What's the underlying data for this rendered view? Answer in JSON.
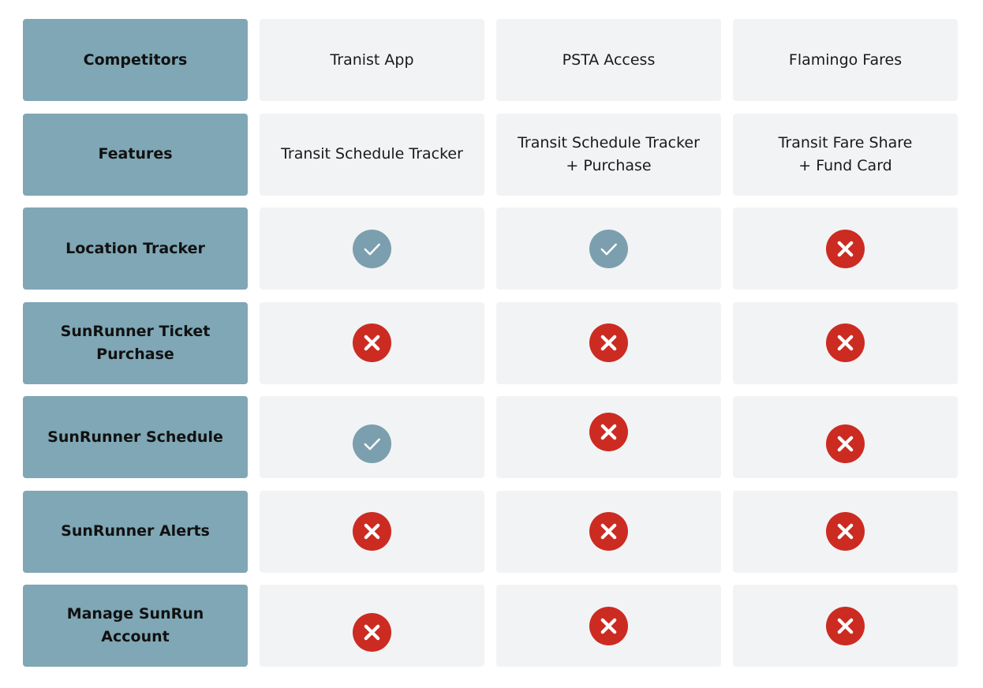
{
  "columns": [
    "Competitors",
    "Tranist App",
    "PSTA Access",
    "Flamingo Fares"
  ],
  "features_row": {
    "label": "Features",
    "values": [
      "Transit Schedule Tracker",
      "Transit Schedule Tracker\n+ Purchase",
      "Transit Fare Share\n+ Fund Card"
    ]
  },
  "rows": [
    {
      "label": "Location Tracker",
      "marks": [
        "check",
        "check",
        "cross"
      ]
    },
    {
      "label": "SunRunner Ticket Purchase",
      "marks": [
        "cross",
        "cross",
        "cross"
      ]
    },
    {
      "label": "SunRunner Schedule",
      "marks": [
        "check",
        "cross",
        "cross"
      ]
    },
    {
      "label": "SunRunner Alerts",
      "marks": [
        "cross",
        "cross",
        "cross"
      ]
    },
    {
      "label": "Manage SunRun Account",
      "marks": [
        "cross",
        "cross",
        "cross"
      ]
    }
  ],
  "icons": {
    "check": "check-circle-icon",
    "cross": "x-circle-icon"
  },
  "colors": {
    "header": "#7fa7b5",
    "cell": "#f2f3f5",
    "check": "#7b9fae",
    "cross": "#cc2b22"
  }
}
